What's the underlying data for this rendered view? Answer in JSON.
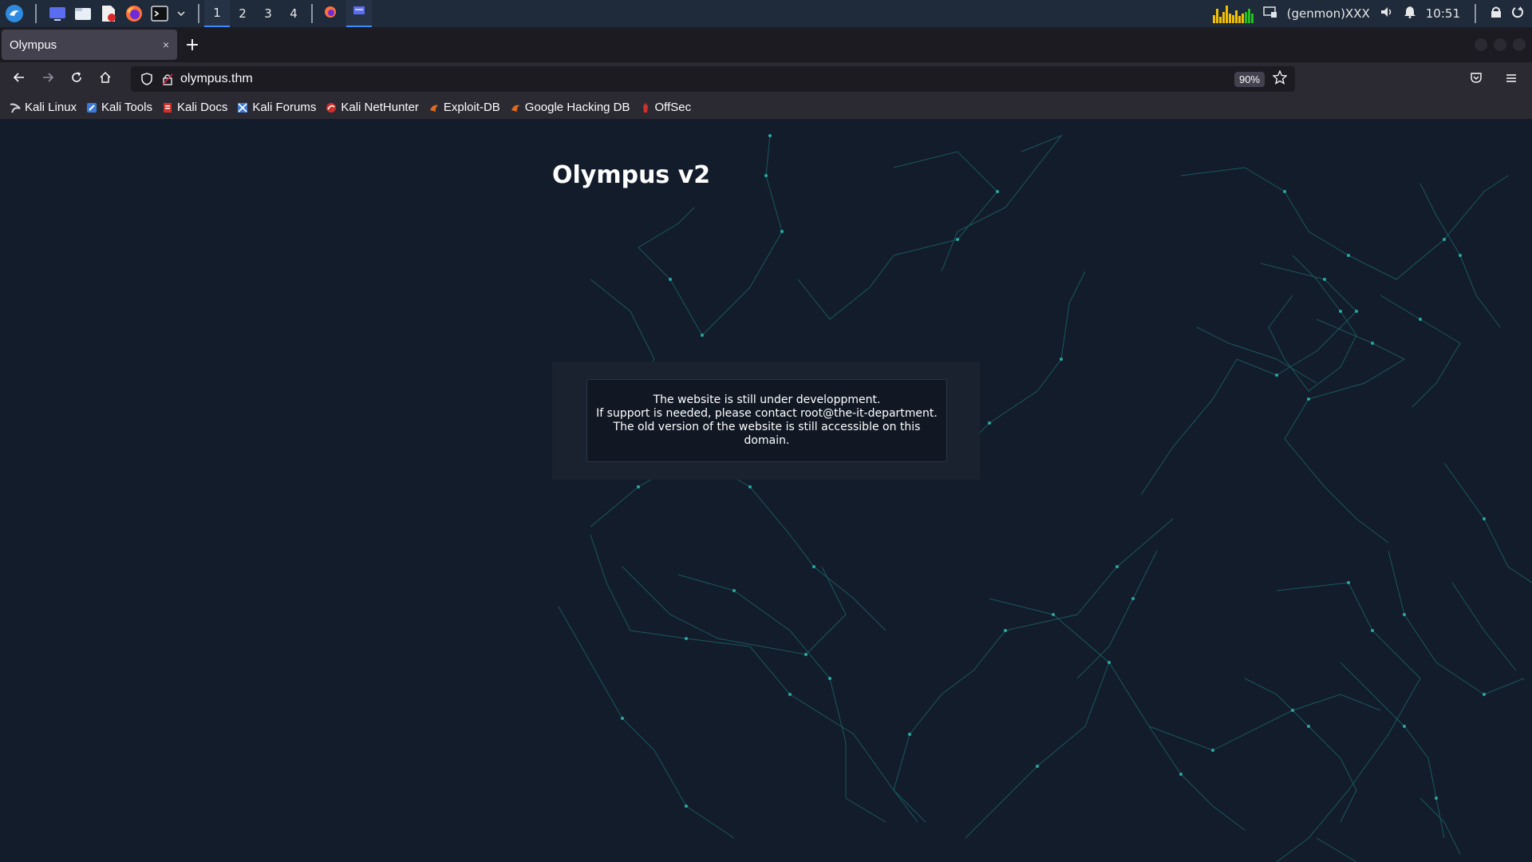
{
  "panel": {
    "launcher_icons": [
      "kali-menu-icon",
      "desktop-icon",
      "file-manager-icon",
      "text-editor-icon",
      "firefox-icon",
      "terminal-icon"
    ],
    "workspaces": [
      "1",
      "2",
      "3",
      "4"
    ],
    "active_workspace": "1",
    "genmon": "(genmon)XXX",
    "clock": "10:51",
    "accent_color": "#3d8bff"
  },
  "browser": {
    "tab_title": "Olympus",
    "tab_close": "×",
    "new_tab": "+",
    "url": "olympus.thm",
    "zoom": "90%",
    "bookmarks": [
      {
        "label": "Kali Linux",
        "icon": "kali-dragon-icon",
        "color": "#cfd3d8"
      },
      {
        "label": "Kali Tools",
        "icon": "kali-tools-icon",
        "color": "#3b7bd5"
      },
      {
        "label": "Kali Docs",
        "icon": "kali-docs-icon",
        "color": "#d0302a"
      },
      {
        "label": "Kali Forums",
        "icon": "kali-forums-icon",
        "color": "#3b7bd5"
      },
      {
        "label": "Kali NetHunter",
        "icon": "nethunter-icon",
        "color": "#d0302a"
      },
      {
        "label": "Exploit-DB",
        "icon": "exploitdb-icon",
        "color": "#e06a1e"
      },
      {
        "label": "Google Hacking DB",
        "icon": "ghdb-icon",
        "color": "#e06a1e"
      },
      {
        "label": "OffSec",
        "icon": "offsec-icon",
        "color": "#d0302a"
      }
    ]
  },
  "page": {
    "title": "Olympus v2",
    "message_lines": [
      "The website is still under developpment.",
      "If support is needed, please contact root@the-it-department.",
      "The old version of the website is still accessible on this",
      "domain."
    ],
    "background_color": "#131c2b",
    "network_color": "#1f8a86"
  }
}
